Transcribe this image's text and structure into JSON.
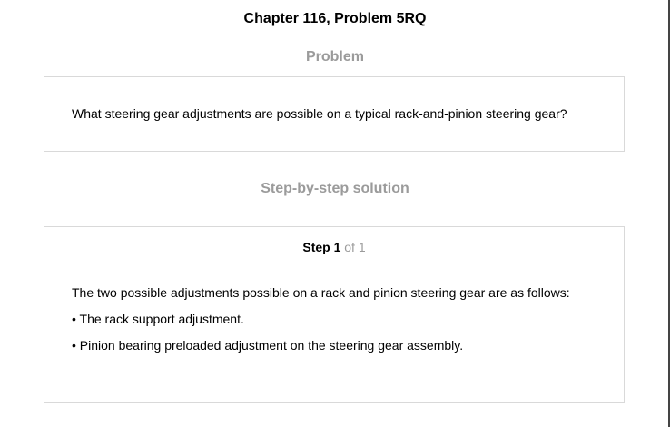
{
  "header": {
    "title": "Chapter 116, Problem 5RQ"
  },
  "problem": {
    "heading": "Problem",
    "question": "What steering gear adjustments are possible on a typical rack-and-pinion steering gear?"
  },
  "solution": {
    "heading": "Step-by-step solution",
    "step_label": "Step 1",
    "step_of": " of 1",
    "lines": [
      "The two possible adjustments possible on a rack and pinion steering gear are as follows:",
      "• The rack support adjustment.",
      "• Pinion bearing preloaded adjustment on the steering gear assembly."
    ]
  }
}
